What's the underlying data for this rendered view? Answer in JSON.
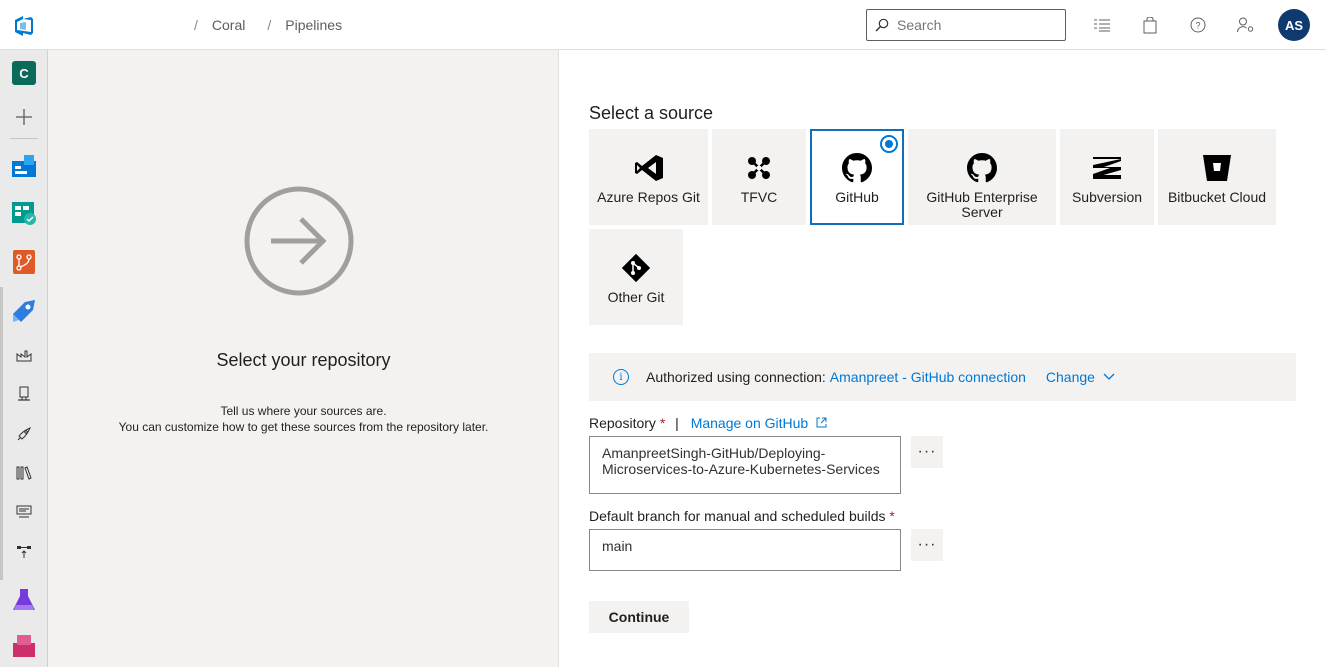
{
  "topbar": {
    "breadcrumbs": [
      "Coral",
      "Pipelines"
    ],
    "search_placeholder": "Search",
    "avatar_initials": "AS"
  },
  "leftnav": {
    "project_initial": "C"
  },
  "left_panel": {
    "title": "Select your repository",
    "line1": "Tell us where your sources are.",
    "line2": "You can customize how to get these sources from the repository later."
  },
  "source": {
    "title": "Select a source",
    "options": [
      {
        "label": "Azure Repos Git",
        "icon": "visual-studio-icon"
      },
      {
        "label": "TFVC",
        "icon": "tfvc-icon"
      },
      {
        "label": "GitHub",
        "icon": "github-icon",
        "selected": true
      },
      {
        "label": "GitHub Enterprise Server",
        "icon": "github-icon"
      },
      {
        "label": "Subversion",
        "icon": "subversion-icon"
      },
      {
        "label": "Bitbucket Cloud",
        "icon": "bitbucket-icon"
      },
      {
        "label": "Other Git",
        "icon": "git-icon"
      }
    ]
  },
  "connection": {
    "prefix": "Authorized using connection:",
    "name": "Amanpreet - GitHub connection",
    "change_label": "Change"
  },
  "repository": {
    "label": "Repository",
    "required_mark": "*",
    "manage_link": "Manage on GitHub",
    "value": "AmanpreetSingh-GitHub/Deploying-Microservices-to-Azure-Kubernetes-Services",
    "more_label": "···"
  },
  "branch": {
    "label": "Default branch for manual and scheduled builds",
    "required_mark": "*",
    "value": "main",
    "more_label": "···"
  },
  "continue_label": "Continue",
  "colors": {
    "accent": "#0078d4",
    "panel_bg": "#f3f2f1",
    "avatar_bg": "#0e3a6e"
  }
}
